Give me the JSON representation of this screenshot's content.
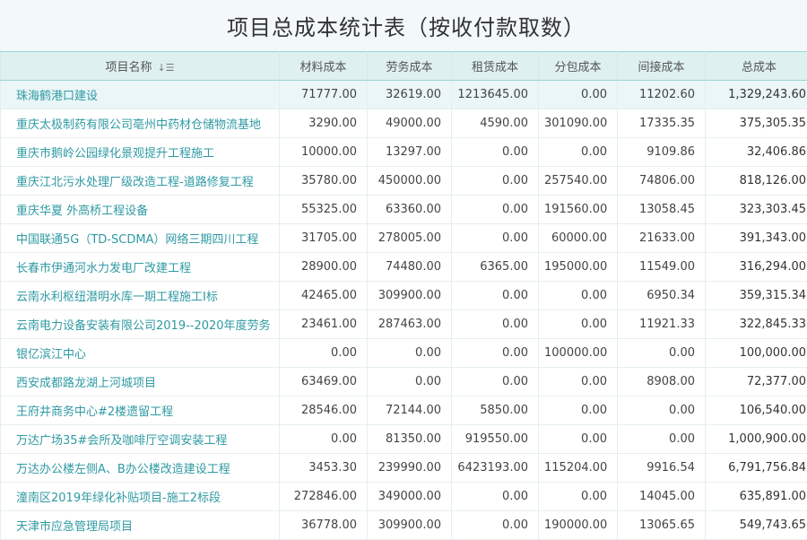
{
  "title": "项目总成本统计表（按收付款取数）",
  "columns": [
    "项目名称",
    "材料成本",
    "劳务成本",
    "租赁成本",
    "分包成本",
    "间接成本",
    "总成本"
  ],
  "sort_icon": "sort-icon",
  "rows": [
    {
      "name": "珠海鹤港口建设",
      "material": "71777.00",
      "labor": "32619.00",
      "rental": "1213645.00",
      "subcontract": "0.00",
      "indirect": "11202.60",
      "total": "1,329,243.60"
    },
    {
      "name": "重庆太极制药有限公司亳州中药材仓储物流基地",
      "material": "3290.00",
      "labor": "49000.00",
      "rental": "4590.00",
      "subcontract": "301090.00",
      "indirect": "17335.35",
      "total": "375,305.35"
    },
    {
      "name": "重庆市鹅岭公园绿化景观提升工程施工",
      "material": "10000.00",
      "labor": "13297.00",
      "rental": "0.00",
      "subcontract": "0.00",
      "indirect": "9109.86",
      "total": "32,406.86"
    },
    {
      "name": "重庆江北污水处理厂级改造工程-道路修复工程",
      "material": "35780.00",
      "labor": "450000.00",
      "rental": "0.00",
      "subcontract": "257540.00",
      "indirect": "74806.00",
      "total": "818,126.00"
    },
    {
      "name": "重庆华夏 外高桥工程设备",
      "material": "55325.00",
      "labor": "63360.00",
      "rental": "0.00",
      "subcontract": "191560.00",
      "indirect": "13058.45",
      "total": "323,303.45"
    },
    {
      "name": "中国联通5G（TD-SCDMA）网络三期四川工程",
      "material": "31705.00",
      "labor": "278005.00",
      "rental": "0.00",
      "subcontract": "60000.00",
      "indirect": "21633.00",
      "total": "391,343.00"
    },
    {
      "name": "长春市伊通河水力发电厂改建工程",
      "material": "28900.00",
      "labor": "74480.00",
      "rental": "6365.00",
      "subcontract": "195000.00",
      "indirect": "11549.00",
      "total": "316,294.00"
    },
    {
      "name": "云南水利枢纽潜明水库一期工程施工I标",
      "material": "42465.00",
      "labor": "309900.00",
      "rental": "0.00",
      "subcontract": "0.00",
      "indirect": "6950.34",
      "total": "359,315.34"
    },
    {
      "name": "云南电力设备安装有限公司2019--2020年度劳务",
      "material": "23461.00",
      "labor": "287463.00",
      "rental": "0.00",
      "subcontract": "0.00",
      "indirect": "11921.33",
      "total": "322,845.33"
    },
    {
      "name": "银亿滨江中心",
      "material": "0.00",
      "labor": "0.00",
      "rental": "0.00",
      "subcontract": "100000.00",
      "indirect": "0.00",
      "total": "100,000.00"
    },
    {
      "name": "西安成都路龙湖上河城项目",
      "material": "63469.00",
      "labor": "0.00",
      "rental": "0.00",
      "subcontract": "0.00",
      "indirect": "8908.00",
      "total": "72,377.00"
    },
    {
      "name": "王府井商务中心#2楼遗留工程",
      "material": "28546.00",
      "labor": "72144.00",
      "rental": "5850.00",
      "subcontract": "0.00",
      "indirect": "0.00",
      "total": "106,540.00"
    },
    {
      "name": "万达广场35#会所及咖啡厅空调安装工程",
      "material": "0.00",
      "labor": "81350.00",
      "rental": "919550.00",
      "subcontract": "0.00",
      "indirect": "0.00",
      "total": "1,000,900.00"
    },
    {
      "name": "万达办公楼左侧A、B办公楼改造建设工程",
      "material": "3453.30",
      "labor": "239990.00",
      "rental": "6423193.00",
      "subcontract": "115204.00",
      "indirect": "9916.54",
      "total": "6,791,756.84"
    },
    {
      "name": "潼南区2019年绿化补贴项目-施工2标段",
      "material": "272846.00",
      "labor": "349000.00",
      "rental": "0.00",
      "subcontract": "0.00",
      "indirect": "14045.00",
      "total": "635,891.00"
    },
    {
      "name": "天津市应急管理局项目",
      "material": "36778.00",
      "labor": "309900.00",
      "rental": "0.00",
      "subcontract": "190000.00",
      "indirect": "13065.65",
      "total": "549,743.65"
    }
  ],
  "colors": {
    "accent": "#2f9aa3",
    "header_bg": "#dff0f1",
    "title_bg": "#f3f9fb",
    "selected_bg": "#eaf6f7"
  }
}
